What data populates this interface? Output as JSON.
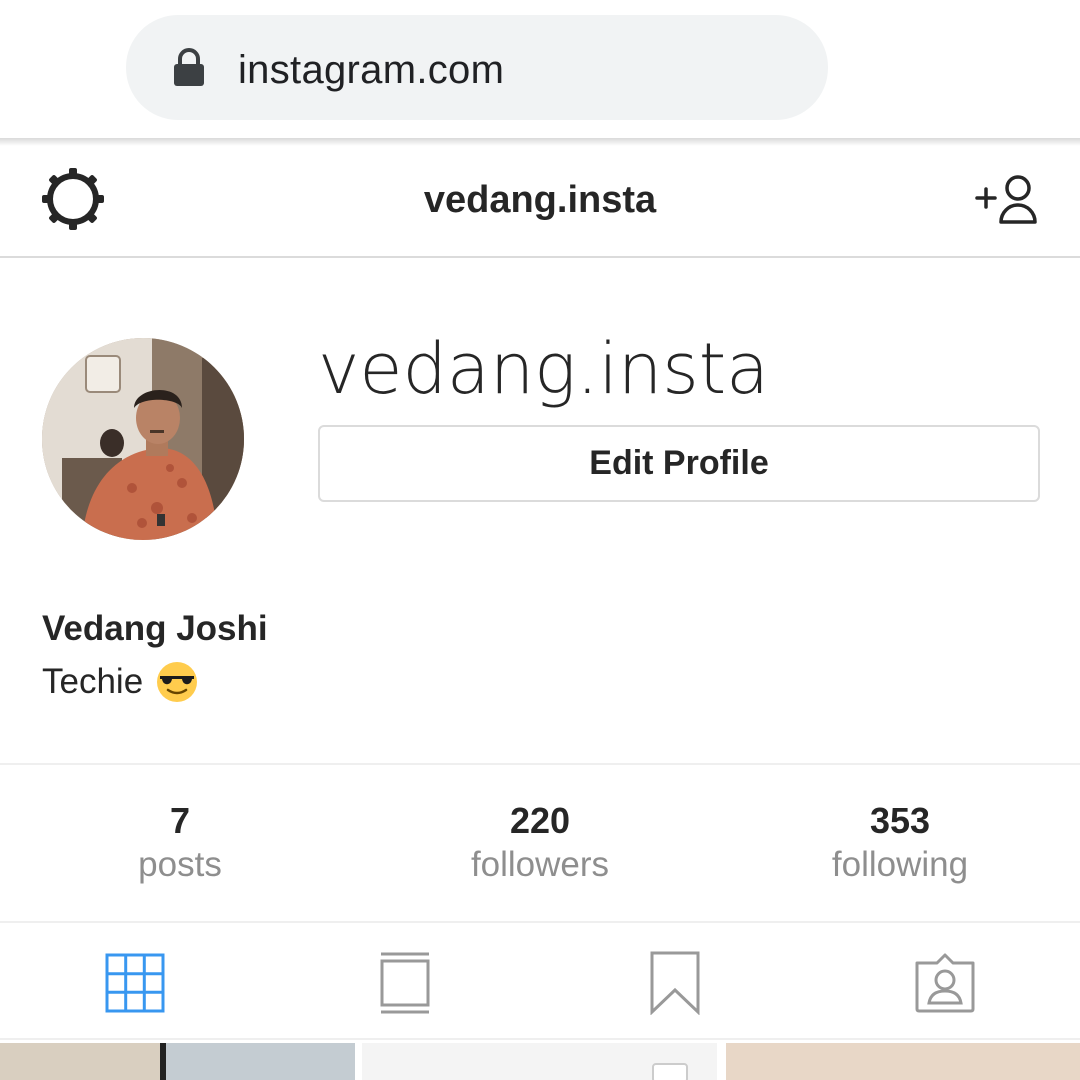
{
  "browser": {
    "url": "instagram.com"
  },
  "header": {
    "title": "vedang.insta",
    "settings_icon": "gear-icon",
    "discover_icon": "add-user-icon"
  },
  "profile": {
    "username": "vedang.insta",
    "edit_button_label": "Edit Profile",
    "full_name": "Vedang Joshi",
    "bio": "Techie",
    "bio_emoji": "sunglasses-face-emoji"
  },
  "stats": [
    {
      "value": "7",
      "label": "posts"
    },
    {
      "value": "220",
      "label": "followers"
    },
    {
      "value": "353",
      "label": "following"
    }
  ],
  "tabs": [
    {
      "name": "grid",
      "icon": "grid-icon",
      "active": true
    },
    {
      "name": "feed",
      "icon": "feed-icon",
      "active": false
    },
    {
      "name": "saved",
      "icon": "bookmark-icon",
      "active": false
    },
    {
      "name": "tagged",
      "icon": "tagged-icon",
      "active": false
    }
  ],
  "colors": {
    "active_tab": "#3897f0",
    "inactive_tab": "#999999",
    "muted_text": "#8e8e8e",
    "border": "#dbdbdb"
  }
}
